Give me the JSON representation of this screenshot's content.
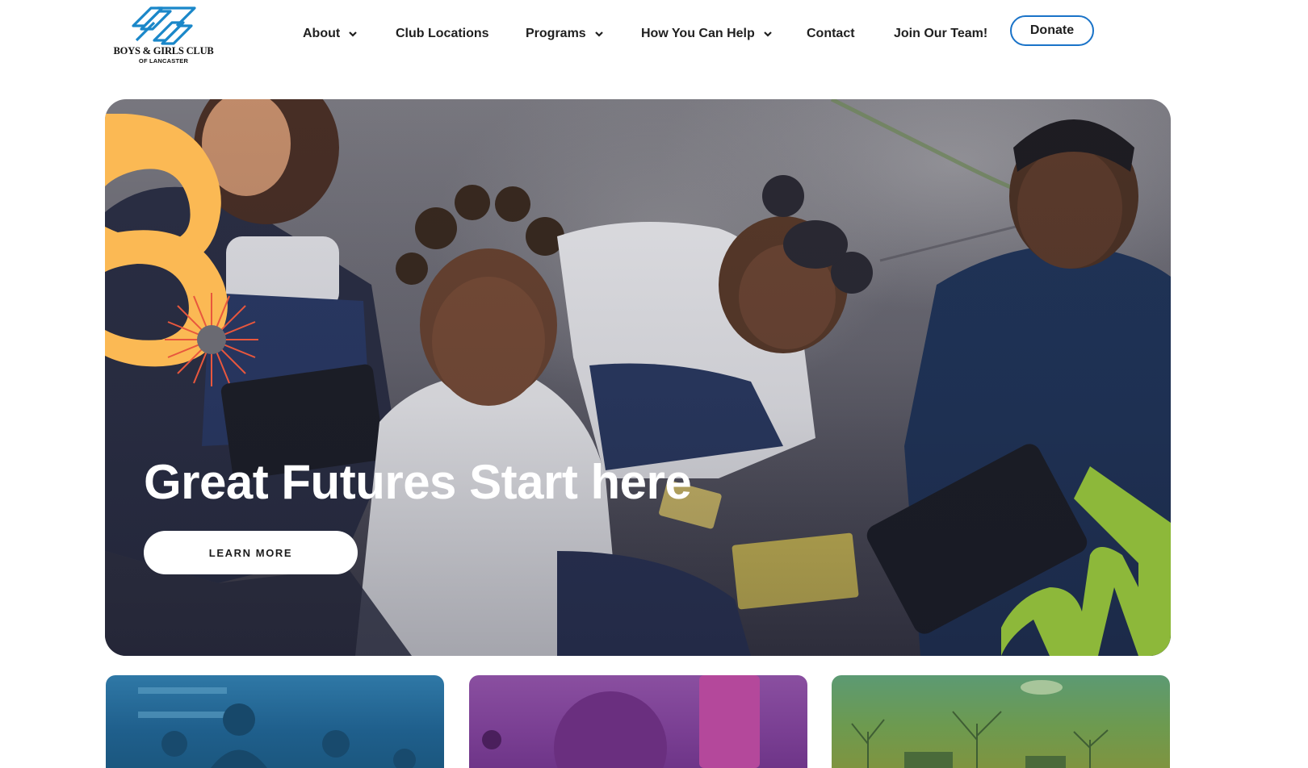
{
  "header": {
    "logo": {
      "name": "BOYS & GIRLS CLUB",
      "subtitle": "OF LANCASTER",
      "icon": "clasped-hands-logo-icon"
    },
    "nav": [
      {
        "label": "About",
        "has_dropdown": true
      },
      {
        "label": "Club Locations",
        "has_dropdown": false
      },
      {
        "label": "Programs",
        "has_dropdown": true
      },
      {
        "label": "How You Can Help",
        "has_dropdown": true
      },
      {
        "label": "Contact",
        "has_dropdown": false
      },
      {
        "label": "Join Our Team!",
        "has_dropdown": false
      }
    ],
    "donate_label": "Donate"
  },
  "hero": {
    "title": "Great Futures Start here",
    "button_label": "LEARN MORE"
  },
  "cards": [
    {
      "theme": "blue"
    },
    {
      "theme": "purple"
    },
    {
      "theme": "green"
    }
  ],
  "colors": {
    "accent_blue": "#1a73c8",
    "orange": "#fbb954",
    "burst_red": "#e8573d",
    "lime": "#8db83a",
    "white": "#ffffff"
  }
}
